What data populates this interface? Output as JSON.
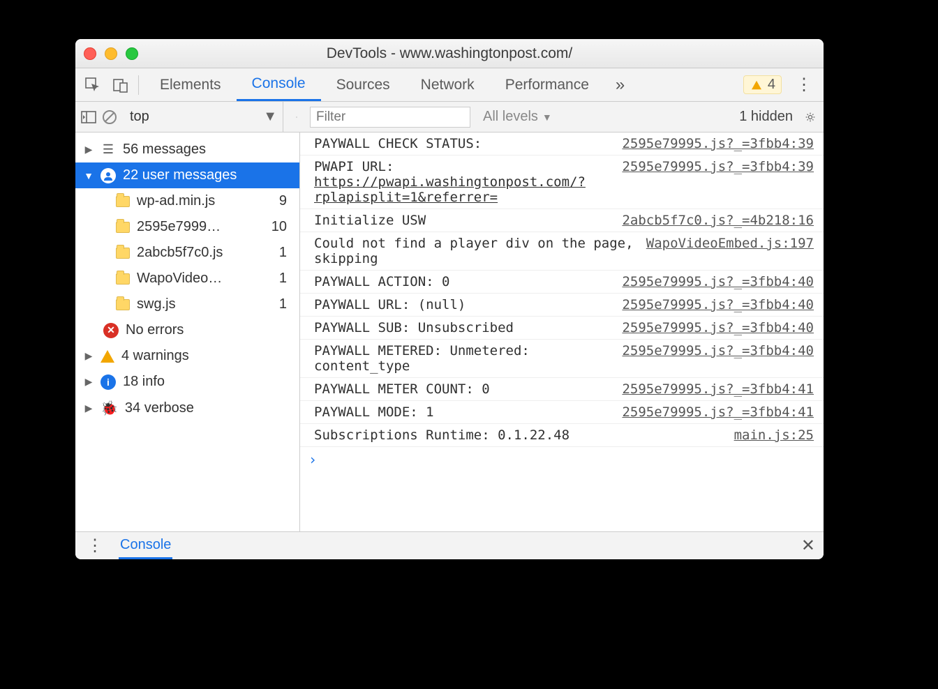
{
  "window": {
    "title": "DevTools - www.washingtonpost.com/"
  },
  "tabs": {
    "items": [
      "Elements",
      "Console",
      "Sources",
      "Network",
      "Performance"
    ],
    "active_index": 1,
    "more_glyph": "»",
    "warning_count": "4"
  },
  "filterbar": {
    "context": "top",
    "filter_placeholder": "Filter",
    "levels_label": "All levels",
    "hidden_label": "1 hidden"
  },
  "sidebar": {
    "messages": {
      "label": "56 messages"
    },
    "user_messages": {
      "label": "22 user messages"
    },
    "files": [
      {
        "name": "wp-ad.min.js",
        "count": "9"
      },
      {
        "name": "2595e7999…",
        "count": "10"
      },
      {
        "name": "2abcb5f7c0.js",
        "count": "1"
      },
      {
        "name": "WapoVideo…",
        "count": "1"
      },
      {
        "name": "swg.js",
        "count": "1"
      }
    ],
    "errors": {
      "label": "No errors"
    },
    "warnings": {
      "label": "4 warnings"
    },
    "info": {
      "label": "18 info"
    },
    "verbose": {
      "label": "34 verbose"
    }
  },
  "console": {
    "rows": [
      {
        "msg_pre": "PAYWALL CHECK STATUS:",
        "msg_link": "",
        "src": "2595e79995.js?_=3fbb4:39"
      },
      {
        "msg_pre": "PWAPI URL: ",
        "msg_link": "https://pwapi.washingtonpost.com/?rplapisplit=1&referrer=",
        "src": "2595e79995.js?_=3fbb4:39"
      },
      {
        "msg_pre": "Initialize USW",
        "msg_link": "",
        "src": "2abcb5f7c0.js?_=4b218:16"
      },
      {
        "msg_pre": "Could not find a player div on the page, skipping",
        "msg_link": "",
        "src": "WapoVideoEmbed.js:197"
      },
      {
        "msg_pre": "PAYWALL ACTION: 0",
        "msg_link": "",
        "src": "2595e79995.js?_=3fbb4:40"
      },
      {
        "msg_pre": "PAYWALL URL: (null)",
        "msg_link": "",
        "src": "2595e79995.js?_=3fbb4:40"
      },
      {
        "msg_pre": "PAYWALL SUB: Unsubscribed",
        "msg_link": "",
        "src": "2595e79995.js?_=3fbb4:40"
      },
      {
        "msg_pre": "PAYWALL METERED: Unmetered: content_type",
        "msg_link": "",
        "src": "2595e79995.js?_=3fbb4:40"
      },
      {
        "msg_pre": "PAYWALL METER COUNT: 0",
        "msg_link": "",
        "src": "2595e79995.js?_=3fbb4:41"
      },
      {
        "msg_pre": "PAYWALL MODE: 1",
        "msg_link": "",
        "src": "2595e79995.js?_=3fbb4:41"
      },
      {
        "msg_pre": "Subscriptions Runtime: 0.1.22.48",
        "msg_link": "",
        "src": "main.js:25"
      }
    ],
    "prompt": "›"
  },
  "drawer": {
    "tab": "Console"
  }
}
